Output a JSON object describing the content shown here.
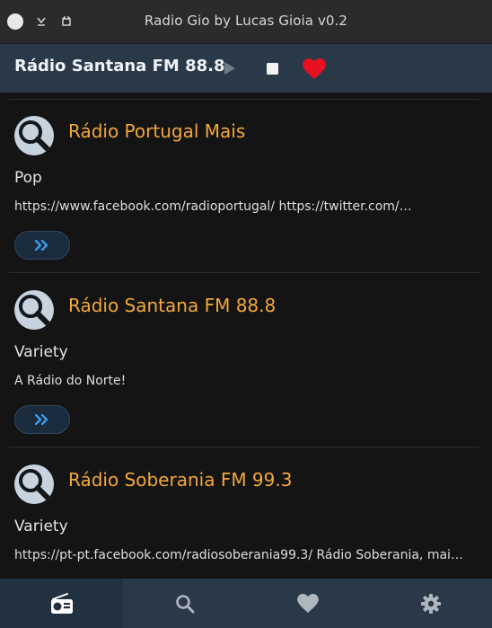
{
  "window": {
    "title": "Radio Gio by Lucas Gioia v0.2"
  },
  "now_playing": {
    "station": "Rádio Santana FM 88.8",
    "favorite_color": "#e81020"
  },
  "stations": [
    {
      "name": "Rádio Portugal Mais",
      "genre": "Pop",
      "description": "https://www.facebook.com/radioportugal/ https://twitter.com/…"
    },
    {
      "name": "Rádio Santana FM 88.8",
      "genre": "Variety",
      "description": "A Rádio do Norte!"
    },
    {
      "name": "Rádio Soberania FM 99.3",
      "genre": "Variety",
      "description": "https://pt-pt.facebook.com/radiosoberania99.3/ Rádio Soberania, mai…"
    }
  ],
  "nav": {
    "items": [
      {
        "icon": "radio-icon",
        "active": true
      },
      {
        "icon": "search-icon",
        "active": false
      },
      {
        "icon": "heart-icon",
        "active": false
      },
      {
        "icon": "gear-icon",
        "active": false
      }
    ]
  },
  "colors": {
    "accent": "#f3a73c",
    "header_bg": "#2a3948",
    "background": "#141414"
  }
}
